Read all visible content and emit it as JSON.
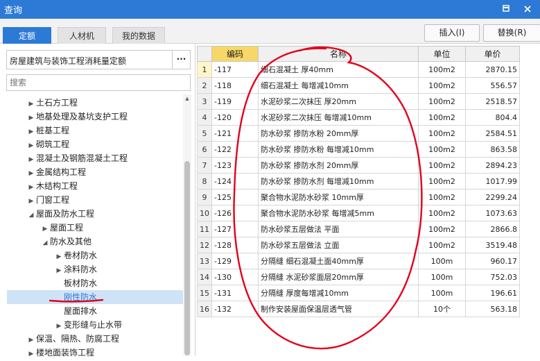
{
  "window": {
    "title": "查询"
  },
  "colors": {
    "titlebar": "#2d7ad6",
    "active_tab": "#2d7ad6",
    "code_header": "#f7d767",
    "annotation": "#e3001b"
  },
  "icons": {
    "pin": "pin-icon",
    "close": "close-icon"
  },
  "tabs": [
    {
      "label": "定额",
      "active": true
    },
    {
      "label": "人材机",
      "active": false
    },
    {
      "label": "我的数据",
      "active": false
    }
  ],
  "actions": {
    "insert": "插入(I)",
    "replace": "替换(R)"
  },
  "library": {
    "name": "房屋建筑与装饰工程消耗量定额",
    "more": "···"
  },
  "search": {
    "placeholder": "搜索",
    "value": ""
  },
  "tree": [
    {
      "label": "土石方工程",
      "level": 0,
      "expand": "collapsed",
      "selected": false
    },
    {
      "label": "地基处理及基坑支护工程",
      "level": 0,
      "expand": "collapsed",
      "selected": false
    },
    {
      "label": "桩基工程",
      "level": 0,
      "expand": "collapsed",
      "selected": false
    },
    {
      "label": "砌筑工程",
      "level": 0,
      "expand": "collapsed",
      "selected": false
    },
    {
      "label": "混凝土及钢筋混凝土工程",
      "level": 0,
      "expand": "collapsed",
      "selected": false
    },
    {
      "label": "金属结构工程",
      "level": 0,
      "expand": "collapsed",
      "selected": false
    },
    {
      "label": "木结构工程",
      "level": 0,
      "expand": "collapsed",
      "selected": false
    },
    {
      "label": "门窗工程",
      "level": 0,
      "expand": "collapsed",
      "selected": false
    },
    {
      "label": "屋面及防水工程",
      "level": 0,
      "expand": "expanded",
      "selected": false
    },
    {
      "label": "屋面工程",
      "level": 1,
      "expand": "collapsed",
      "selected": false
    },
    {
      "label": "防水及其他",
      "level": 1,
      "expand": "expanded",
      "selected": false
    },
    {
      "label": "卷材防水",
      "level": 2,
      "expand": "collapsed",
      "selected": false
    },
    {
      "label": "涂料防水",
      "level": 2,
      "expand": "collapsed",
      "selected": false
    },
    {
      "label": "板材防水",
      "level": 2,
      "expand": "none",
      "selected": false
    },
    {
      "label": "刚性防水",
      "level": 2,
      "expand": "none",
      "selected": true
    },
    {
      "label": "屋面排水",
      "level": 2,
      "expand": "none",
      "selected": false
    },
    {
      "label": "变形缝与止水带",
      "level": 2,
      "expand": "collapsed",
      "selected": false
    },
    {
      "label": "保温、隔热、防腐工程",
      "level": 0,
      "expand": "collapsed",
      "selected": false
    },
    {
      "label": "楼地面装饰工程",
      "level": 0,
      "expand": "collapsed",
      "selected": false
    }
  ],
  "table": {
    "headers": {
      "index": "",
      "code": "编码",
      "name": "名称",
      "unit": "单位",
      "price": "单价"
    },
    "rows": [
      {
        "idx": "1",
        "code": "-117",
        "name": "细石混凝土 厚40mm",
        "unit": "100m2",
        "price": "2870.15"
      },
      {
        "idx": "2",
        "code": "-118",
        "name": "细石混凝土 每增减10mm",
        "unit": "100m2",
        "price": "556.57"
      },
      {
        "idx": "3",
        "code": "-119",
        "name": "水泥砂浆二次抹压 厚20mm",
        "unit": "100m2",
        "price": "2518.57"
      },
      {
        "idx": "4",
        "code": "-120",
        "name": "水泥砂浆二次抹压 每增减10mm",
        "unit": "100m2",
        "price": "804.4"
      },
      {
        "idx": "5",
        "code": "-121",
        "name": "防水砂浆 掺防水粉 20mm厚",
        "unit": "100m2",
        "price": "2584.51"
      },
      {
        "idx": "6",
        "code": "-122",
        "name": "防水砂浆 掺防水粉 每增减10mm",
        "unit": "100m2",
        "price": "863.58"
      },
      {
        "idx": "7",
        "code": "-123",
        "name": "防水砂浆 掺防水剂 20mm厚",
        "unit": "100m2",
        "price": "2894.23"
      },
      {
        "idx": "8",
        "code": "-124",
        "name": "防水砂浆 掺防水剂 每增减10mm",
        "unit": "100m2",
        "price": "1017.99"
      },
      {
        "idx": "9",
        "code": "-125",
        "name": "聚合物水泥防水砂浆 10mm厚",
        "unit": "100m2",
        "price": "2299.24"
      },
      {
        "idx": "10",
        "code": "-126",
        "name": "聚合物水泥防水砂浆 每增减5mm",
        "unit": "100m2",
        "price": "1073.63"
      },
      {
        "idx": "11",
        "code": "-127",
        "name": "防水砂浆五层做法 平面",
        "unit": "100m2",
        "price": "2866.8"
      },
      {
        "idx": "12",
        "code": "-128",
        "name": "防水砂浆五层做法 立面",
        "unit": "100m2",
        "price": "3519.48"
      },
      {
        "idx": "13",
        "code": "-129",
        "name": "分隔缝 细石混凝土面40mm厚",
        "unit": "100m",
        "price": "960.17"
      },
      {
        "idx": "14",
        "code": "-130",
        "name": "分隔缝 水泥砂浆面层20mm厚",
        "unit": "100m",
        "price": "752.03"
      },
      {
        "idx": "15",
        "code": "-131",
        "name": "分隔缝 厚度每增减10mm",
        "unit": "100m",
        "price": "196.61"
      },
      {
        "idx": "16",
        "code": "-132",
        "name": "制作安装屋面保温层透气管",
        "unit": "10个",
        "price": "563.18"
      }
    ]
  }
}
